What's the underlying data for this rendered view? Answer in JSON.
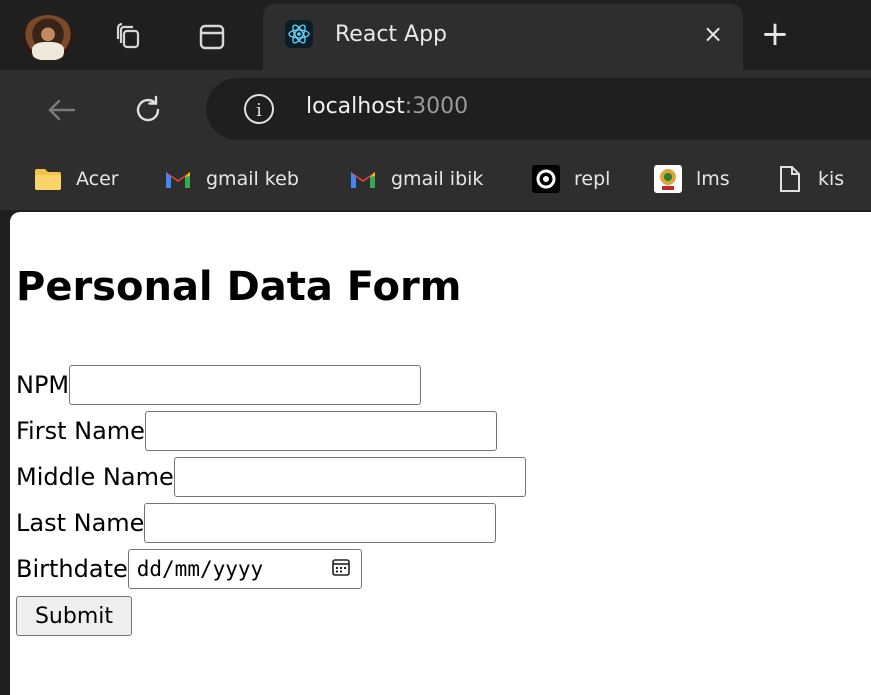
{
  "tab": {
    "title": "React App",
    "close_glyph": "×",
    "new_tab_glyph": "+"
  },
  "address": {
    "host": "localhost",
    "port": ":3000",
    "info_glyph": "i"
  },
  "bookmarks": [
    {
      "label": "Acer",
      "icon": "folder-icon"
    },
    {
      "label": "gmail keb",
      "icon": "gmail-icon"
    },
    {
      "label": "gmail ibik",
      "icon": "gmail-icon"
    },
    {
      "label": "repl",
      "icon": "replit-icon"
    },
    {
      "label": "lms",
      "icon": "lms-icon"
    },
    {
      "label": "kis",
      "icon": "page-icon"
    }
  ],
  "page": {
    "title": "Personal Data Form",
    "fields": [
      {
        "label": "NPM",
        "value": ""
      },
      {
        "label": "First Name",
        "value": ""
      },
      {
        "label": "Middle Name",
        "value": ""
      },
      {
        "label": "Last Name",
        "value": ""
      }
    ],
    "birthdate": {
      "label": "Birthdate",
      "placeholder": "dd/mm/yyyy"
    },
    "submit_label": "Submit"
  },
  "colors": {
    "chrome_dark": "#1f1f1f",
    "chrome_mid": "#2e2e2e",
    "page_bg": "#ffffff"
  }
}
